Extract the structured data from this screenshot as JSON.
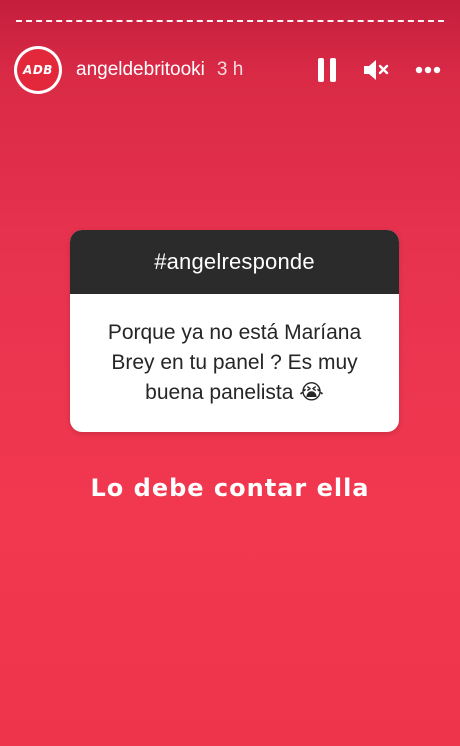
{
  "header": {
    "avatar_text": "ADB",
    "username": "angeldebritooki",
    "time_ago": "3 h"
  },
  "question_card": {
    "title": "#angelresponde",
    "question": "Porque ya no está Maríana\nBrey en tu panel ? Es muy\nbuena panelista 😭"
  },
  "answer_text": "Lo debe contar ella",
  "icons": [
    "pause-icon",
    "mute-icon",
    "more-icon"
  ],
  "colors": {
    "background_top": "#c41e3d",
    "background_main": "#f2384f",
    "card_header": "#2b2b2b",
    "card_body": "#ffffff",
    "avatar": "#e3283c"
  }
}
